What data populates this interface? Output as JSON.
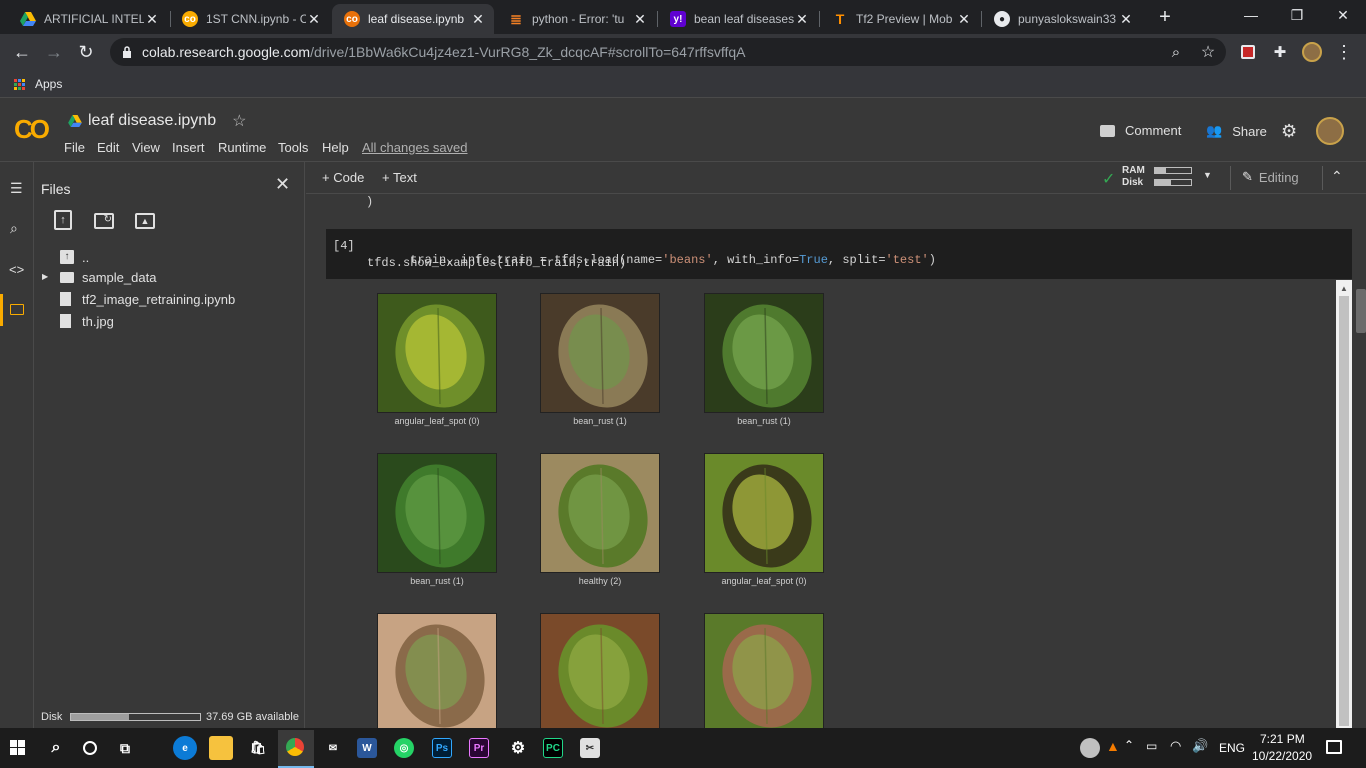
{
  "browser": {
    "tabs": [
      {
        "title": "ARTIFICIAL INTELLI",
        "icon": "google-drive-icon"
      },
      {
        "title": "1ST CNN.ipynb - C",
        "icon": "colab-icon"
      },
      {
        "title": "leaf disease.ipynb",
        "icon": "colab-icon"
      },
      {
        "title": "python - Error: 'tu",
        "icon": "stackoverflow-icon"
      },
      {
        "title": "bean leaf diseases",
        "icon": "yahoo-icon"
      },
      {
        "title": "Tf2 Preview | Mob",
        "icon": "tensorflow-icon"
      },
      {
        "title": "punyaslokswain33",
        "icon": "github-icon"
      }
    ],
    "url_host": "colab.research.google.com",
    "url_path": "/drive/1BbWa6kCu4jz4ez1-VurRG8_Zk_dcqcAF#scrollTo=647rffsvffqA",
    "bookmarks": [
      {
        "label": "Apps"
      }
    ]
  },
  "colab": {
    "logo": "CO",
    "notebook_title": "leaf disease.ipynb",
    "menu": [
      "File",
      "Edit",
      "View",
      "Insert",
      "Runtime",
      "Tools",
      "Help"
    ],
    "save_status": "All changes saved",
    "comment_label": "Comment",
    "share_label": "Share"
  },
  "sidebar": {
    "title": "Files",
    "items": [
      {
        "label": "..",
        "type": "parent"
      },
      {
        "label": "sample_data",
        "type": "folder"
      },
      {
        "label": "tf2_image_retraining.ipynb",
        "type": "file"
      },
      {
        "label": "th.jpg",
        "type": "file"
      }
    ],
    "disk_label": "Disk",
    "disk_available": "37.69 GB available",
    "disk_used_fraction": 0.45
  },
  "notebook": {
    "add_code": "Code",
    "add_text": "Text",
    "ram_label": "RAM",
    "disk_label": "Disk",
    "editing_label": "Editing",
    "prev_line": ")",
    "cell_index": "[4]",
    "code_lines": [
      "train, info_train = tfds.load(name='beans', with_info=True, split='test')",
      "tfds.show_examples(info_train,train)"
    ],
    "examples": [
      {
        "label": "angular_leaf_spot (0)"
      },
      {
        "label": "bean_rust (1)"
      },
      {
        "label": "bean_rust (1)"
      },
      {
        "label": "bean_rust (1)"
      },
      {
        "label": "healthy (2)"
      },
      {
        "label": "angular_leaf_spot (0)"
      },
      {
        "label": ""
      },
      {
        "label": ""
      },
      {
        "label": ""
      }
    ]
  },
  "taskbar": {
    "language": "ENG",
    "time": "7:21 PM",
    "date": "10/22/2020"
  },
  "colors": {
    "colab_orange": "#f9ab00",
    "bg_dark": "#383838",
    "code_bg": "#1e1e1e",
    "string": "#ce9178",
    "keyword": "#569cd6"
  }
}
